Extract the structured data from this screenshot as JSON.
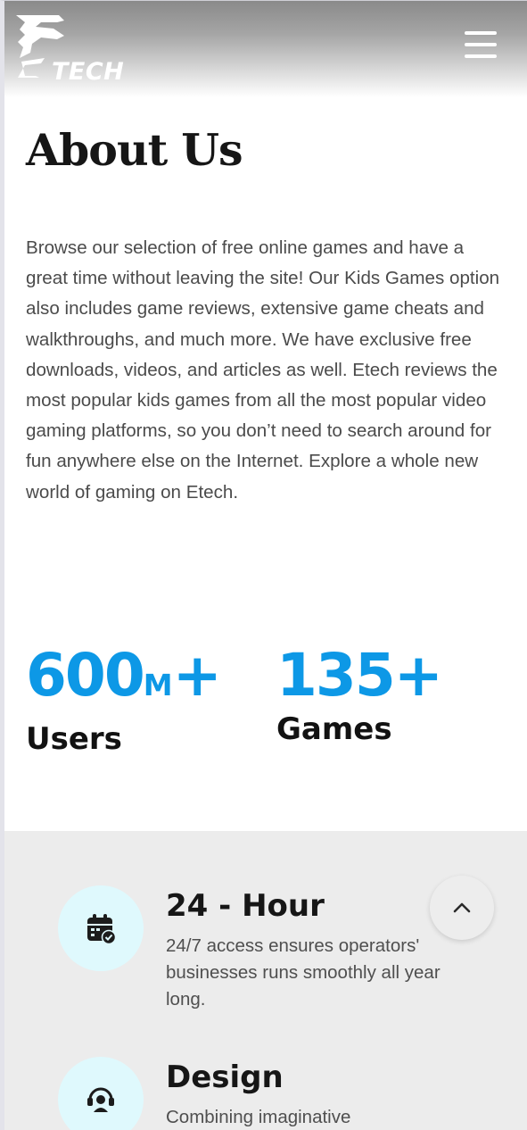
{
  "header": {
    "logo_text": "TECH",
    "menu_icon": "hamburger-menu-icon"
  },
  "about": {
    "title": "About Us",
    "body": "Browse our selection of free online games and have a great time without leaving the site! Our Kids Games option also includes game reviews, extensive game cheats and walkthroughs, and much more. We have exclusive free downloads, videos, and articles as well. Etech reviews the most popular kids games from all the most popular video gaming platforms, so you don’t need to search around for fun anywhere else on the Internet. Explore a whole new world of gaming on Etech."
  },
  "stats": [
    {
      "number": "600",
      "unit": "M",
      "suffix": "+",
      "label": "Users"
    },
    {
      "number": "135",
      "unit": "",
      "suffix": "+",
      "label": "Games"
    }
  ],
  "features": [
    {
      "title": "24 - Hour",
      "description": "24/7 access ensures operators' businesses runs smoothly all year long.",
      "icon": "calendar-check-icon"
    },
    {
      "title": "Design",
      "description": "Combining imaginative",
      "icon": "headset-support-icon"
    }
  ],
  "scroll_top": {
    "icon": "chevron-up-icon"
  },
  "colors": {
    "accent": "#0d98e6",
    "icon_circle": "#dff9fd",
    "features_bg": "#ececec"
  }
}
